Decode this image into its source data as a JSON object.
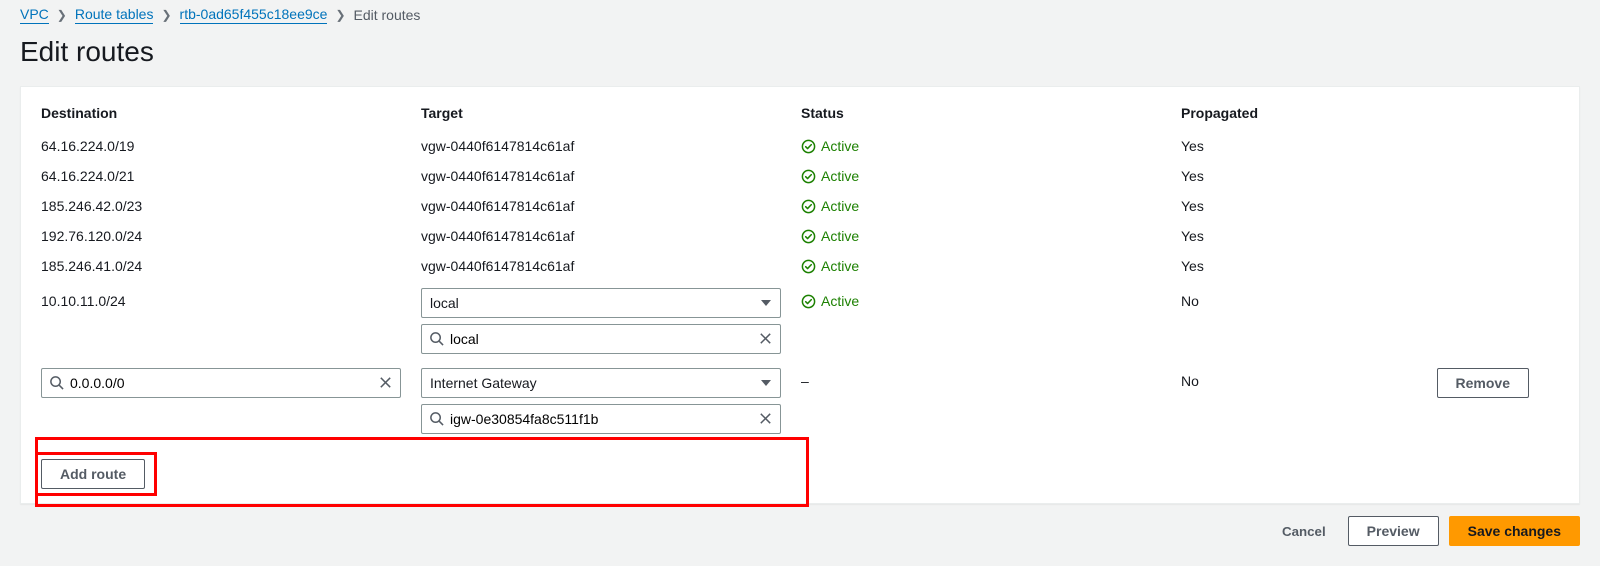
{
  "breadcrumb": {
    "vpc": "VPC",
    "route_tables": "Route tables",
    "rtb_id": "rtb-0ad65f455c18ee9ce",
    "current": "Edit routes"
  },
  "page_title": "Edit routes",
  "columns": {
    "destination": "Destination",
    "target": "Target",
    "status": "Status",
    "propagated": "Propagated"
  },
  "status_labels": {
    "active": "Active",
    "none": "–"
  },
  "prop_labels": {
    "yes": "Yes",
    "no": "No"
  },
  "routes": [
    {
      "destination": "64.16.224.0/19",
      "target": "vgw-0440f6147814c61af",
      "status": "active",
      "propagated": "yes"
    },
    {
      "destination": "64.16.224.0/21",
      "target": "vgw-0440f6147814c61af",
      "status": "active",
      "propagated": "yes"
    },
    {
      "destination": "185.246.42.0/23",
      "target": "vgw-0440f6147814c61af",
      "status": "active",
      "propagated": "yes"
    },
    {
      "destination": "192.76.120.0/24",
      "target": "vgw-0440f6147814c61af",
      "status": "active",
      "propagated": "yes"
    },
    {
      "destination": "185.246.41.0/24",
      "target": "vgw-0440f6147814c61af",
      "status": "active",
      "propagated": "yes"
    }
  ],
  "local_row": {
    "destination": "10.10.11.0/24",
    "target_select": "local",
    "target_search": "local",
    "status": "active",
    "propagated": "no"
  },
  "new_row": {
    "destination_value": "0.0.0.0/0",
    "target_select": "Internet Gateway",
    "target_search": "igw-0e30854fa8c511f1b",
    "status": "none",
    "propagated": "no"
  },
  "buttons": {
    "remove": "Remove",
    "add_route": "Add route",
    "cancel": "Cancel",
    "preview": "Preview",
    "save": "Save changes"
  }
}
